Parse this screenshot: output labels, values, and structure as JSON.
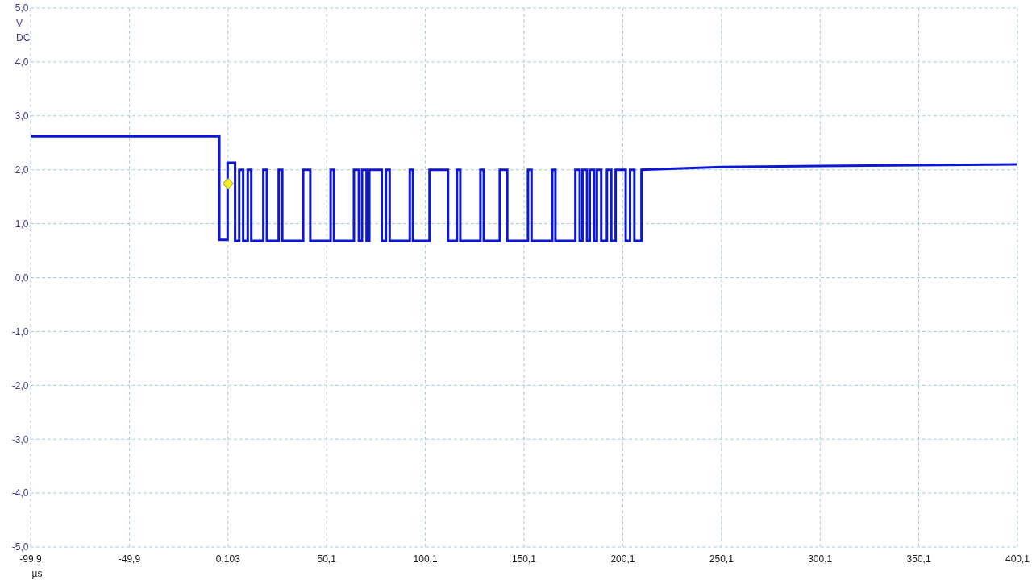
{
  "scope": {
    "coupling": "DC",
    "trigger_marker": true,
    "chart_data": {
      "type": "line",
      "xlabel": "µs",
      "ylabel": "V",
      "xlim": [
        -99.9,
        400.1
      ],
      "ylim": [
        -5,
        5
      ],
      "grid": true,
      "xticks": [
        {
          "value": -99.9,
          "label": "-99,9"
        },
        {
          "value": -49.9,
          "label": "-49,9"
        },
        {
          "value": 0.103,
          "label": "0,103"
        },
        {
          "value": 50.1,
          "label": "50,1"
        },
        {
          "value": 100.1,
          "label": "100,1"
        },
        {
          "value": 150.1,
          "label": "150,1"
        },
        {
          "value": 200.1,
          "label": "200,1"
        },
        {
          "value": 250.1,
          "label": "250,1"
        },
        {
          "value": 300.1,
          "label": "300,1"
        },
        {
          "value": 350.1,
          "label": "350,1"
        },
        {
          "value": 400.1,
          "label": "400,1"
        }
      ],
      "yticks": [
        {
          "value": 5,
          "label": "5,0"
        },
        {
          "value": 4,
          "label": "4,0"
        },
        {
          "value": 3,
          "label": "3,0"
        },
        {
          "value": 2,
          "label": "2,0"
        },
        {
          "value": 1,
          "label": "1,0"
        },
        {
          "value": 0,
          "label": "0,0"
        },
        {
          "value": -1,
          "label": "-1,0"
        },
        {
          "value": -2,
          "label": "-2,0"
        },
        {
          "value": -3,
          "label": "-3,0"
        },
        {
          "value": -4,
          "label": "-4,0"
        },
        {
          "value": -5,
          "label": "-5,0"
        }
      ],
      "x": [
        -99.9,
        -4.3,
        -4.3,
        -0.1,
        -0.1,
        3.7,
        3.7,
        5.8,
        5.8,
        7.8,
        7.8,
        10.1,
        10.1,
        11.9,
        11.9,
        18.0,
        18.0,
        19.8,
        19.8,
        25.8,
        25.8,
        27.6,
        27.6,
        38.2,
        38.2,
        41.8,
        41.8,
        52.1,
        52.1,
        53.8,
        53.8,
        63.9,
        63.9,
        66.4,
        66.4,
        68.0,
        68.0,
        70.3,
        70.3,
        71.7,
        71.7,
        78.0,
        78.0,
        80.1,
        80.1,
        82.0,
        82.0,
        92.2,
        92.2,
        93.8,
        93.8,
        102.2,
        102.2,
        111.6,
        111.6,
        116.1,
        116.1,
        117.8,
        117.8,
        128.0,
        128.0,
        129.7,
        129.7,
        137.8,
        137.8,
        141.6,
        141.6,
        152.1,
        152.1,
        153.9,
        153.9,
        164.4,
        164.4,
        166.0,
        166.0,
        176.1,
        176.1,
        178.3,
        178.3,
        179.7,
        179.7,
        182.0,
        182.0,
        183.4,
        183.4,
        185.6,
        185.6,
        187.0,
        187.0,
        189.2,
        189.2,
        192.1,
        192.1,
        194.3,
        194.3,
        196.5,
        196.5,
        201.6,
        201.6,
        203.8,
        203.8,
        206.0,
        206.0,
        209.6,
        209.6,
        250.1,
        300.1,
        400.1
      ],
      "series": [
        {
          "color": "#0c17d4",
          "values": [
            2.62,
            2.62,
            0.7,
            0.7,
            2.13,
            2.13,
            0.68,
            0.68,
            2.0,
            2.0,
            0.68,
            0.68,
            2.0,
            2.0,
            0.68,
            0.68,
            2.0,
            2.0,
            0.68,
            0.68,
            2.0,
            2.0,
            0.68,
            0.68,
            2.0,
            2.0,
            0.68,
            0.68,
            2.0,
            2.0,
            0.68,
            0.68,
            2.0,
            2.0,
            0.68,
            0.68,
            2.0,
            2.0,
            0.68,
            0.68,
            2.0,
            2.0,
            0.68,
            0.68,
            2.0,
            2.0,
            0.68,
            0.68,
            2.0,
            2.0,
            0.68,
            0.68,
            2.0,
            2.0,
            0.68,
            0.68,
            2.0,
            2.0,
            0.68,
            0.68,
            2.0,
            2.0,
            0.68,
            0.68,
            2.0,
            2.0,
            0.68,
            0.68,
            2.0,
            2.0,
            0.68,
            0.68,
            2.0,
            2.0,
            0.68,
            0.68,
            2.0,
            2.0,
            0.68,
            0.68,
            2.0,
            2.0,
            0.68,
            0.68,
            2.0,
            2.0,
            0.68,
            0.68,
            2.0,
            2.0,
            0.68,
            0.68,
            2.0,
            2.0,
            0.68,
            0.68,
            2.0,
            2.0,
            0.68,
            0.68,
            2.0,
            2.0,
            0.68,
            0.68,
            2.0,
            2.05,
            2.07,
            2.1
          ]
        }
      ]
    }
  }
}
